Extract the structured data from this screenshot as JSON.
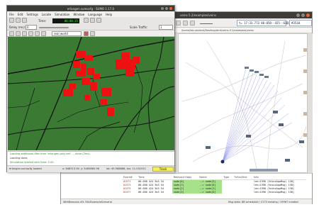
{
  "sumo": {
    "title": "erlangen.sumocfg - SUMO 1.17.0",
    "menu": [
      "File",
      "Edit",
      "Settings",
      "Locate",
      "Simulation",
      "Window",
      "Language",
      "Help"
    ],
    "toolbar": {
      "delay_label": "Delay (ms):",
      "delay_value": "0",
      "time_label": "Time:",
      "time_value": "00:00:35",
      "scale_label": "Scale Traffic:",
      "scale_value": "1"
    },
    "view": {
      "scheme_value": "real world"
    },
    "messages": [
      "Loading additional-files from 'erlangen.poly.xml' ... done (2ms).",
      "Loading done.",
      "Simulation started with time: 0.00."
    ],
    "status": {
      "file": "erlangen.sumocfg loaded",
      "x_coord": "x: 848513.94",
      "y_coord": "y: 5465865.96",
      "lat_lon": "lat: 49.568886, lon: 11.031911",
      "track_label": "Track"
    },
    "colors": {
      "map_background": "#3a7a33",
      "buildings": "#ee1111",
      "roads": "#111111",
      "time_display_text": "#3cf03c"
    }
  },
  "omnet": {
    "title": "veins-5.2/examples/veins",
    "toolbar": {
      "sim_time": "t= 17:33.773  86-050--425--630-405",
      "event_number": "#3510"
    },
    "path_text": "/home/lab-student/Desktop/dmt/veins-5.2/examples/veins",
    "log_columns": [
      "Event#",
      "Time",
      "Relevant Hops",
      "Name",
      "Type",
      "TxSrc/Sink",
      "Info"
    ],
    "log_rows": [
      [
        "#1571",
        "86.050 424 5k3 54",
        "node[0]",
        "--> node[5]",
        "",
        "",
        "len=1398 (VeinsAppMsg) 138]"
      ],
      [
        "#1573",
        "86.050 424 5k3 54",
        "node[1]",
        "--> node[8]",
        "",
        "",
        "len=1398 (VeinsAppMsg) 138]"
      ],
      [
        "#1575",
        "86.050 424 5k3 54",
        "node[2]",
        "--> node[3]",
        "",
        "",
        "len=1398 (VeinsAppMsg) 138]"
      ],
      [
        "#1577",
        "86.050 424 5k3 54",
        "node[3]",
        "--> node[6]",
        "",
        "",
        "len=1398 (VeinsAppMsg) 138]"
      ]
    ],
    "status_left": "WithBeacons #0: RSUExampleScenario",
    "status_right": "Msg stats: 88 scheduled / 2170 existing / 19967 created"
  }
}
